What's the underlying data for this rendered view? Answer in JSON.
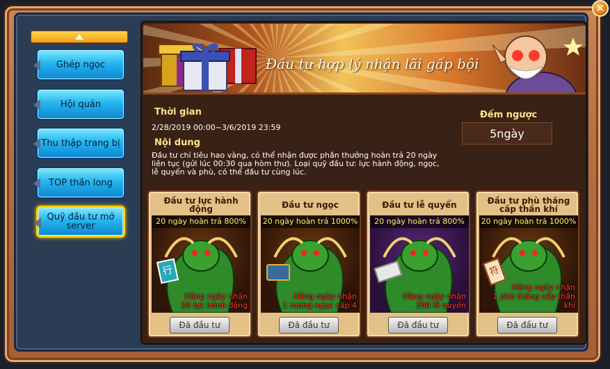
{
  "sidebar": {
    "items": [
      {
        "label": "Ghép ngọc"
      },
      {
        "label": "Hội quán"
      },
      {
        "label": "Thu thập trang bị"
      },
      {
        "label": "TOP thần long"
      },
      {
        "label": "Quỹ đầu tư mở server"
      }
    ]
  },
  "banner": {
    "title": "Đầu tư hợp lý nhận lãi gấp bội"
  },
  "info": {
    "time_label": "Thời gian",
    "time_value": "2/28/2019 00:00~3/6/2019 23:59",
    "content_label": "Nội dung",
    "content_text": "Đầu tư chỉ tiêu hao vàng, có thể nhận được phần thưởng hoàn trả 20 ngày liên tục (gửi lúc 00:30 qua hòm thư). Loại quỹ đầu tư: lực hành động, ngọc, lễ quyển và phù, có thể đầu tư cùng lúc.",
    "countdown_label": "Đếm ngược",
    "countdown_value": "5ngày"
  },
  "cards": [
    {
      "title": "Đầu tư lực hành động",
      "rate": "20 ngày hoàn trả 800%",
      "reward1": "Hằng ngày nhận",
      "reward2": "20 lực hành động",
      "button": "Đã đầu tư",
      "icon": "action-points-icon"
    },
    {
      "title": "Đầu tư ngọc",
      "rate": "20 ngày hoàn trả 1000%",
      "reward1": "Hằng ngày nhận",
      "reward2": "1 rương ngọc cấp 4",
      "button": "Đã đầu tư",
      "icon": "gem-chest-icon"
    },
    {
      "title": "Đầu tư lễ quyển",
      "rate": "20 ngày hoàn trả 800%",
      "reward1": "Hằng ngày nhận",
      "reward2": "200 lễ quyển",
      "button": "Đã đầu tư",
      "icon": "voucher-icon"
    },
    {
      "title": "Đầu tư phù thăng cấp thần khí",
      "rate": "20 ngày hoàn trả 1000%",
      "reward1": "Hằng ngày nhận",
      "reward2": "1 phù thăng cấp thần khí",
      "button": "Đã đầu tư",
      "icon": "talisman-icon"
    }
  ]
}
